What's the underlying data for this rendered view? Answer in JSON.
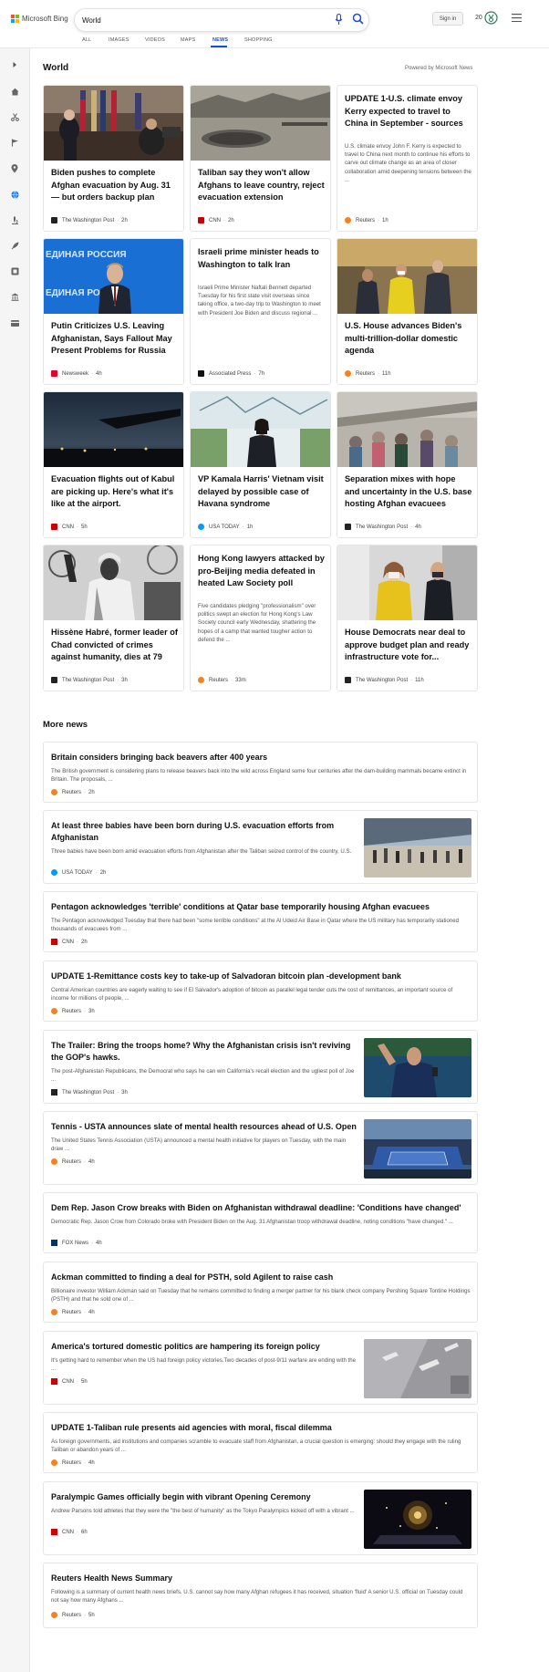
{
  "header": {
    "brand": "Microsoft Bing",
    "search_value": "World",
    "sign_in": "Sign in",
    "points": "20",
    "logo_colors": [
      "#f35325",
      "#81bc06",
      "#05a6f0",
      "#ffba08"
    ]
  },
  "tabs": [
    {
      "label": "ALL"
    },
    {
      "label": "IMAGES"
    },
    {
      "label": "VIDEOS"
    },
    {
      "label": "MAPS"
    },
    {
      "label": "NEWS",
      "active": true
    },
    {
      "label": "SHOPPING"
    }
  ],
  "sidebar": {
    "items": [
      "chevron-right-icon",
      "home-icon",
      "scissors-icon",
      "flag-icon",
      "location-pin-icon",
      "globe-icon",
      "microscope-icon",
      "rocket-icon",
      "film-icon",
      "bank-icon",
      "credit-card-icon"
    ]
  },
  "section": {
    "title": "World",
    "powered_by": "Powered by Microsoft News"
  },
  "cards": [
    {
      "title": "Biden pushes to complete Afghan evacuation by Aug. 31 — but orders backup plan",
      "source": "The Washington Post",
      "time": "2h",
      "source_color": "#222"
    },
    {
      "title": "Taliban say they won't allow Afghans to leave country, reject evacuation extension",
      "source": "CNN",
      "time": "2h",
      "source_color": "#cc0000"
    },
    {
      "title": "UPDATE 1-U.S. climate envoy Kerry expected to travel to China in September - sources",
      "desc": "U.S. climate envoy John F. Kerry is expected to travel to China next month to continue his efforts to carve out climate change as an area of closer collaboration amid deepening tensions between the ...",
      "source": "Reuters",
      "time": "1h",
      "source_color": "#f58220"
    },
    {
      "title": "Putin Criticizes U.S. Leaving Afghanistan, Says Fallout May Present Problems for Russia",
      "source": "Newsweek",
      "time": "4h",
      "source_color": "#e4002b"
    },
    {
      "title": "Israeli prime minister heads to Washington to talk Iran",
      "desc": "Israeli Prime Minister Naftali Bennett departed Tuesday for his first state visit overseas since taking office, a two-day trip to Washington to meet with President Joe Biden and discuss regional ...",
      "source": "Associated Press",
      "time": "7h",
      "source_color": "#111"
    },
    {
      "title": "U.S. House advances Biden's multi-trillion-dollar domestic agenda",
      "source": "Reuters",
      "time": "11h",
      "source_color": "#f58220"
    },
    {
      "title": "Evacuation flights out of Kabul are picking up. Here's what it's like at the airport.",
      "source": "CNN",
      "time": "5h",
      "source_color": "#cc0000"
    },
    {
      "title": "VP Kamala Harris' Vietnam visit delayed by possible case of Havana syndrome",
      "source": "USA TODAY",
      "time": "1h",
      "source_color": "#009bff"
    },
    {
      "title": "Separation mixes with hope and uncertainty in the U.S. base hosting Afghan evacuees",
      "source": "The Washington Post",
      "time": "4h",
      "source_color": "#222"
    },
    {
      "title": "Hissène Habré, former leader of Chad convicted of crimes against humanity, dies at 79",
      "source": "The Washington Post",
      "time": "3h",
      "source_color": "#222"
    },
    {
      "title": "Hong Kong lawyers attacked by pro-Beijing media defeated in heated Law Society poll",
      "desc": "Five candidates pledging \"professionalism\" over politics swept an election for Hong Kong's Law Society council early Wednesday, shattering the hopes of a camp that wanted tougher action to defend the ...",
      "source": "Reuters",
      "time": "33m",
      "source_color": "#f58220"
    },
    {
      "title": "House Democrats near deal to approve budget plan and ready infrastructure vote for...",
      "source": "The Washington Post",
      "time": "11h",
      "source_color": "#222"
    }
  ],
  "more_news": {
    "title": "More news",
    "items": [
      {
        "title": "Britain considers bringing back beavers after 400 years",
        "desc": "The British government is considering plans to release beavers back into the wild across England some four centuries after the dam-building mammals became extinct in Britain. The proposals, ...",
        "source": "Reuters",
        "time": "2h",
        "source_color": "#f58220"
      },
      {
        "title": "At least three babies have been born during U.S. evacuation efforts from Afghanistan",
        "desc": "Three babies have been born amid evacuation efforts from Afghanistan after the Taliban seized control of the country, U.S.",
        "source": "USA TODAY",
        "time": "2h",
        "source_color": "#009bff"
      },
      {
        "title": "Pentagon acknowledges 'terrible' conditions at Qatar base temporarily housing Afghan evacuees",
        "desc": "The Pentagon acknowledged Tuesday that there had been \"some terrible conditions\" at the Al Udeid Air Base in Qatar where the US military has temporarily stationed thousands of evacuees from ...",
        "source": "CNN",
        "time": "2h",
        "source_color": "#cc0000"
      },
      {
        "title": "UPDATE 1-Remittance costs key to take-up of Salvadoran bitcoin plan -development bank",
        "desc": "Central American countries are eagerly waiting to see if El Salvador's adoption of bitcoin as parallel legal tender cuts the cost of remittances, an important source of income for millions of people, ...",
        "source": "Reuters",
        "time": "3h",
        "source_color": "#f58220"
      },
      {
        "title": "The Trailer: Bring the troops home? Why the Afghanistan crisis isn't reviving the GOP's hawks.",
        "desc": "The post-Afghanistan Republicans, the Democrat who says he can win California's recall election and the ugliest poll of Joe ...",
        "source": "The Washington Post",
        "time": "3h",
        "source_color": "#222"
      },
      {
        "title": "Tennis - USTA announces slate of mental health resources ahead of U.S. Open",
        "desc": "The United States Tennis Association (USTA) announced a mental health initiative for players on Tuesday, with the main draw ...",
        "source": "Reuters",
        "time": "4h",
        "source_color": "#f58220"
      },
      {
        "title": "Dem Rep. Jason Crow breaks with Biden on Afghanistan withdrawal deadline: 'Conditions have changed'",
        "desc": "Democratic Rep. Jason Crow from Colorado broke with President Biden on the Aug. 31 Afghanistan troop withdrawal deadline, noting conditions \"have changed.\" ...",
        "source": "FOX News",
        "time": "4h",
        "source_color": "#003366"
      },
      {
        "title": "Ackman committed to finding a deal for PSTH, sold Agilent to raise cash",
        "desc": "Billionaire investor William Ackman said on Tuesday that he remains committed to finding a merger partner for his blank check company Pershing Square Tontine Holdings (PSTH) and that he sold one of ...",
        "source": "Reuters",
        "time": "4h",
        "source_color": "#f58220"
      },
      {
        "title": "America's tortured domestic politics are hampering its foreign policy",
        "desc": "It's getting hard to remember when the US had foreign policy victories.Two decades of post-9/11 warfare are ending with the ...",
        "source": "CNN",
        "time": "5h",
        "source_color": "#cc0000"
      },
      {
        "title": "UPDATE 1-Taliban rule presents aid agencies with moral, fiscal dilemma",
        "desc": "As foreign governments, aid institutions and companies scramble to evacuate staff from Afghanistan, a crucial question is emerging: should they engage with the ruling Taliban or abandon years of ...",
        "source": "Reuters",
        "time": "4h",
        "source_color": "#f58220"
      },
      {
        "title": "Paralympic Games officially begin with vibrant Opening Ceremony",
        "desc": "Andrew Parsons told athletes that they were the \"the best of humanity\" as the Tokyo Paralympics kicked off with a vibrant ...",
        "source": "CNN",
        "time": "6h",
        "source_color": "#cc0000"
      },
      {
        "title": "Reuters Health News Summary",
        "desc": "Following is a summary of current health news briefs. U.S. cannot say how many Afghan refugees it has received, situation 'fluid' A senior U.S. official on Tuesday could not say how many Afghans ...",
        "source": "Reuters",
        "time": "5h",
        "source_color": "#f58220"
      }
    ]
  },
  "russia_banner_text": "ЕДИНАЯ РОССИЯ"
}
